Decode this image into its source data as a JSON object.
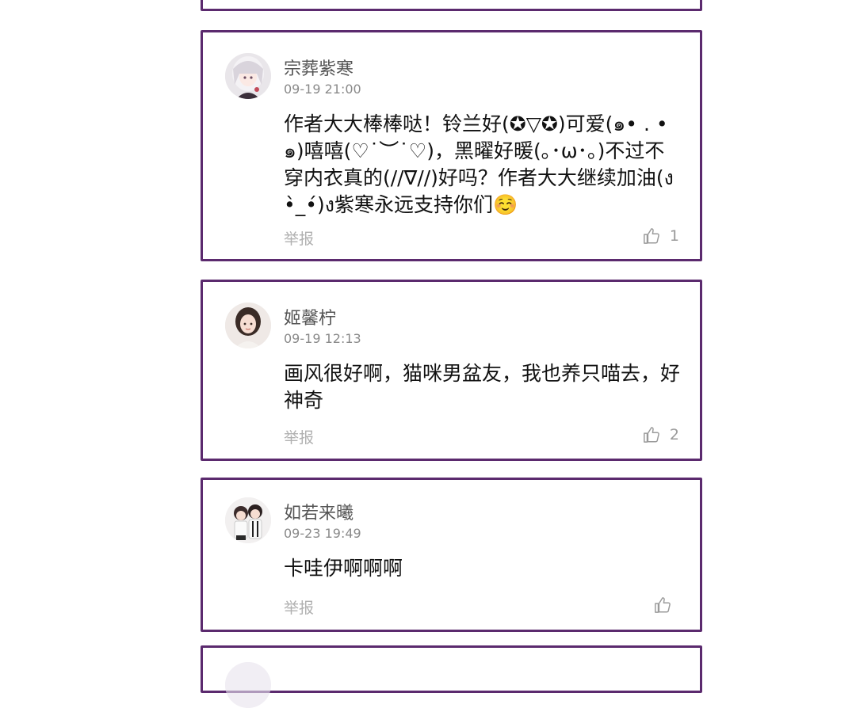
{
  "comments": [
    {
      "username": "宗葬紫寒",
      "time": "09-19 21:00",
      "content": "作者大大棒棒哒！铃兰好(✪▽✪)可爱(๑• . •๑)嘻嘻(♡˙︶˙♡)，黑曜好暖(｡･ω･｡)不过不穿内衣真的(//∇//)好吗？作者大大继续加油(ง •̀_•́)ง紫寒永远支持你们☺️",
      "report_label": "举报",
      "like_count": "1",
      "avatar_icon": "anime-girl-white-hair-avatar"
    },
    {
      "username": "姬馨柠",
      "time": "09-19 12:13",
      "content": "画风很好啊，猫咪男盆友，我也养只喵去，好神奇",
      "report_label": "举报",
      "like_count": "2",
      "avatar_icon": "girl-photo-avatar"
    },
    {
      "username": "如若来曦",
      "time": "09-23 19:49",
      "content": "卡哇伊啊啊啊",
      "report_label": "举报",
      "like_count": "",
      "avatar_icon": "couple-avatar"
    }
  ],
  "colors": {
    "border": "#5b2a6e",
    "username": "#555555",
    "time": "#8a8a8a",
    "report": "#b0b0b0"
  }
}
